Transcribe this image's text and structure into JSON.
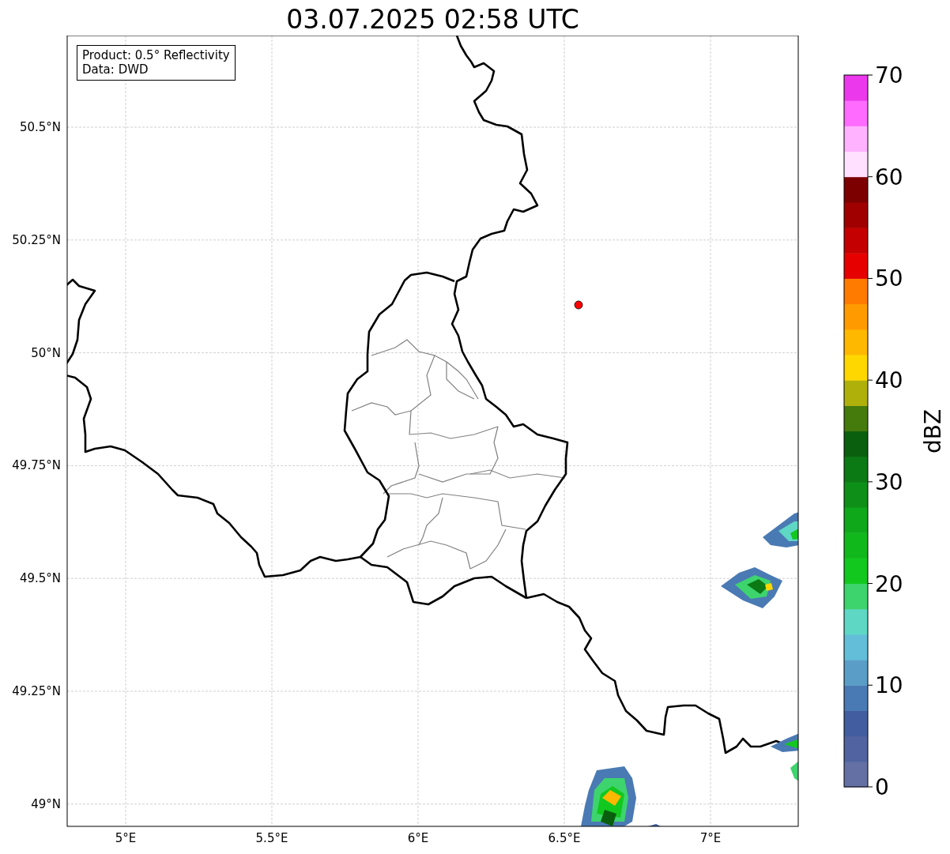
{
  "title": "03.07.2025 02:58 UTC",
  "legend": [
    "Product: 0.5° Reflectivity",
    "Data: DWD"
  ],
  "map": {
    "x_ticks": [
      "5°E",
      "5.5°E",
      "6°E",
      "6.5°E",
      "7°E"
    ],
    "y_ticks": [
      "50.5°N",
      "50.25°N",
      "50°N",
      "49.75°N",
      "49.5°N",
      "49.25°N",
      "49°N"
    ]
  },
  "colorbar": {
    "label": "dBZ",
    "ticks": [
      "70",
      "60",
      "50",
      "40",
      "30",
      "20",
      "10",
      "0"
    ],
    "bins": [
      {
        "color": "#6470a4"
      },
      {
        "color": "#5163a0"
      },
      {
        "color": "#425da0"
      },
      {
        "color": "#4a7ab3"
      },
      {
        "color": "#5a9ec8"
      },
      {
        "color": "#63bfd9"
      },
      {
        "color": "#5fd7c5"
      },
      {
        "color": "#3dd46e"
      },
      {
        "color": "#12c81e"
      },
      {
        "color": "#10b81c"
      },
      {
        "color": "#0fa81b"
      },
      {
        "color": "#0e8f18"
      },
      {
        "color": "#0b7a14"
      },
      {
        "color": "#0a5f0e"
      },
      {
        "color": "#457a0c"
      },
      {
        "color": "#afb10a"
      },
      {
        "color": "#ffd700"
      },
      {
        "color": "#ffb800"
      },
      {
        "color": "#ff9b00"
      },
      {
        "color": "#ff7b00"
      },
      {
        "color": "#e60000"
      },
      {
        "color": "#c40000"
      },
      {
        "color": "#a00000"
      },
      {
        "color": "#7c0000"
      },
      {
        "color": "#ffe0ff"
      },
      {
        "color": "#ffb2ff"
      },
      {
        "color": "#ff6bff"
      },
      {
        "color": "#ec38ec"
      }
    ]
  }
}
